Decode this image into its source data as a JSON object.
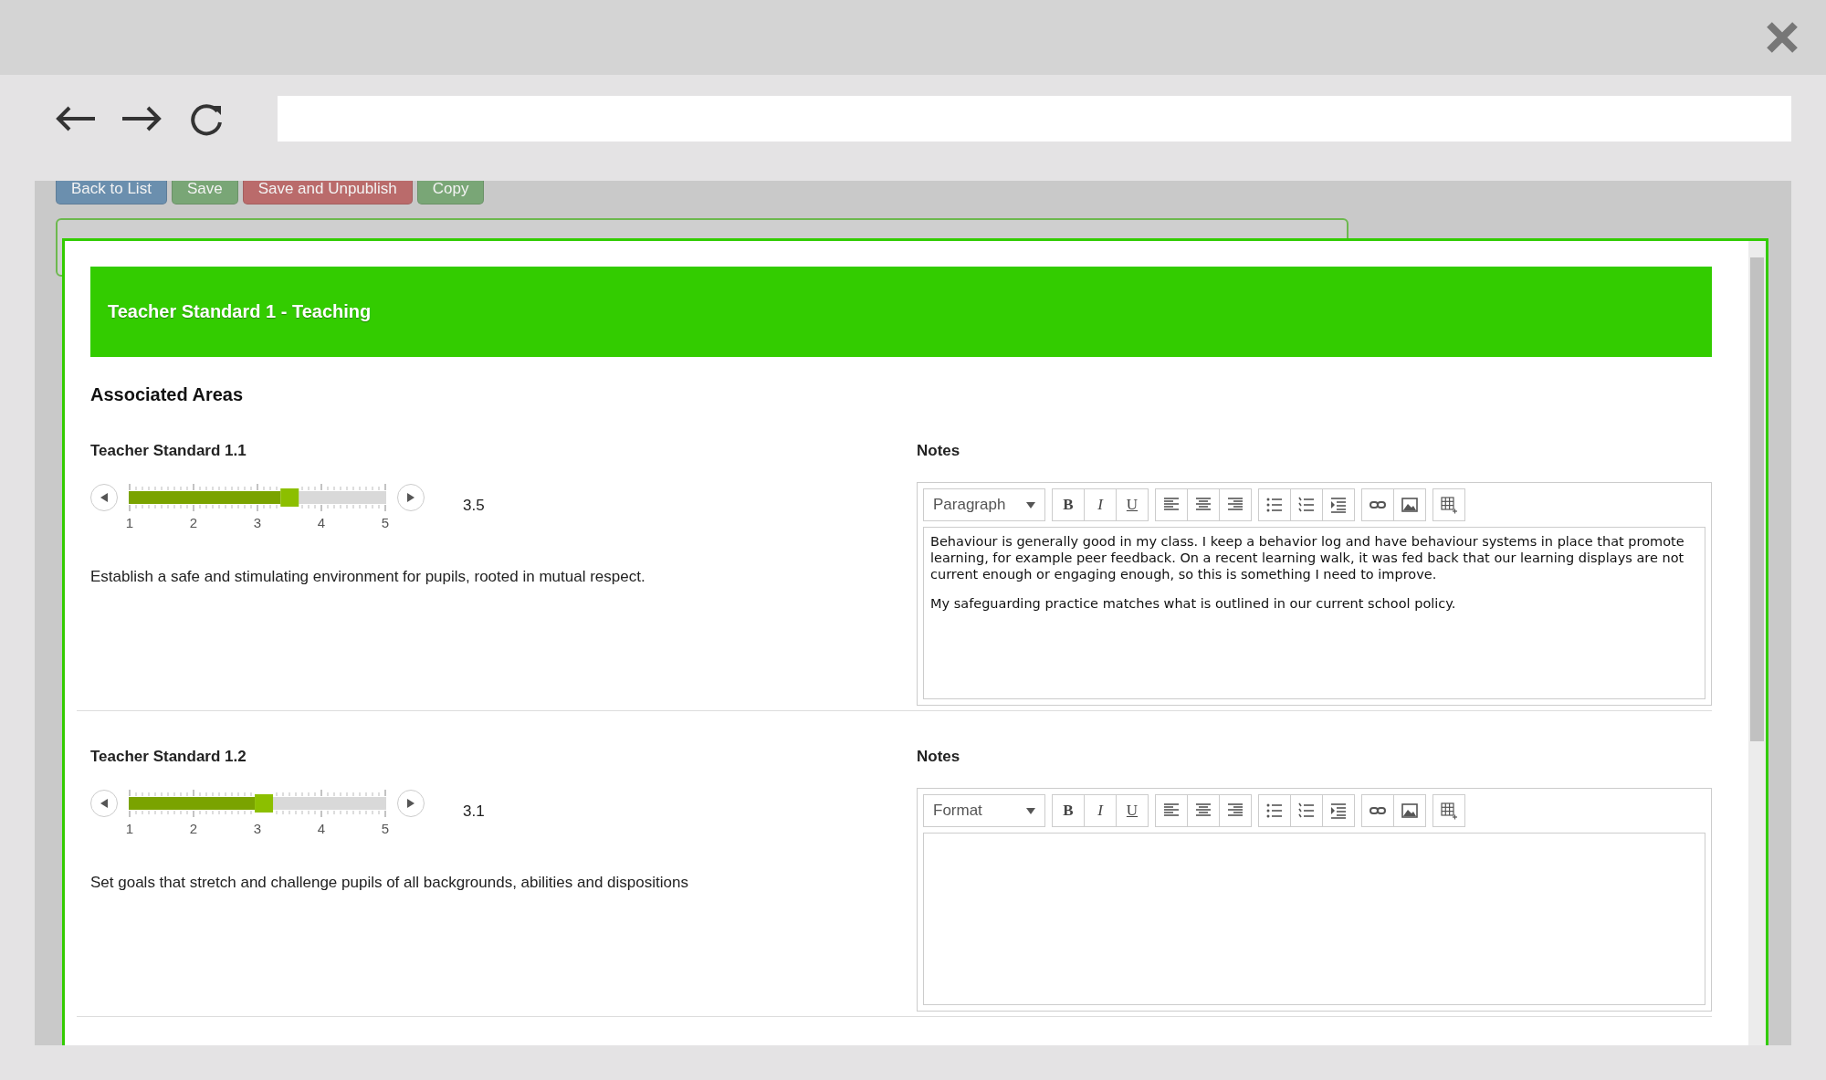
{
  "page_buttons": [
    {
      "label": "Back to List",
      "color": "#6b8fae"
    },
    {
      "label": "Save",
      "color": "#79a676"
    },
    {
      "label": "Save and Unpublish",
      "color": "#ba6b6b"
    },
    {
      "label": "Copy",
      "color": "#79a676"
    }
  ],
  "header": {
    "title": "Teacher Standard 1 - Teaching"
  },
  "subheading": "Associated Areas",
  "sections": [
    {
      "title": "Teacher Standard 1.1",
      "level": 0.625,
      "reading": "3.5",
      "ticks": [
        "1",
        "2",
        "3",
        "4",
        "5"
      ],
      "description": "Establish a safe and stimulating environment for pupils, rooted in mutual respect.",
      "notes_label": "Notes",
      "editor": {
        "format": "Paragraph",
        "style_buttons": [
          "B",
          "I",
          "U"
        ],
        "paragraphs": [
          "Behaviour is generally good in my class. I keep a behavior log and have behaviour systems in place that promote learning, for example peer feedback. On a recent learning walk, it was fed back that our learning displays are not current enough or engaging enough, so this is something I need to improve.",
          "My safeguarding practice matches what is outlined in our current school policy."
        ]
      }
    },
    {
      "title": "Teacher Standard 1.2",
      "level": 0.525,
      "reading": "3.1",
      "ticks": [
        "1",
        "2",
        "3",
        "4",
        "5"
      ],
      "description": "Set goals that stretch and challenge pupils of all backgrounds, abilities and dispositions",
      "notes_label": "Notes",
      "editor": {
        "format": "Format",
        "style_buttons": [
          "B",
          "I",
          "U"
        ]
      }
    }
  ]
}
